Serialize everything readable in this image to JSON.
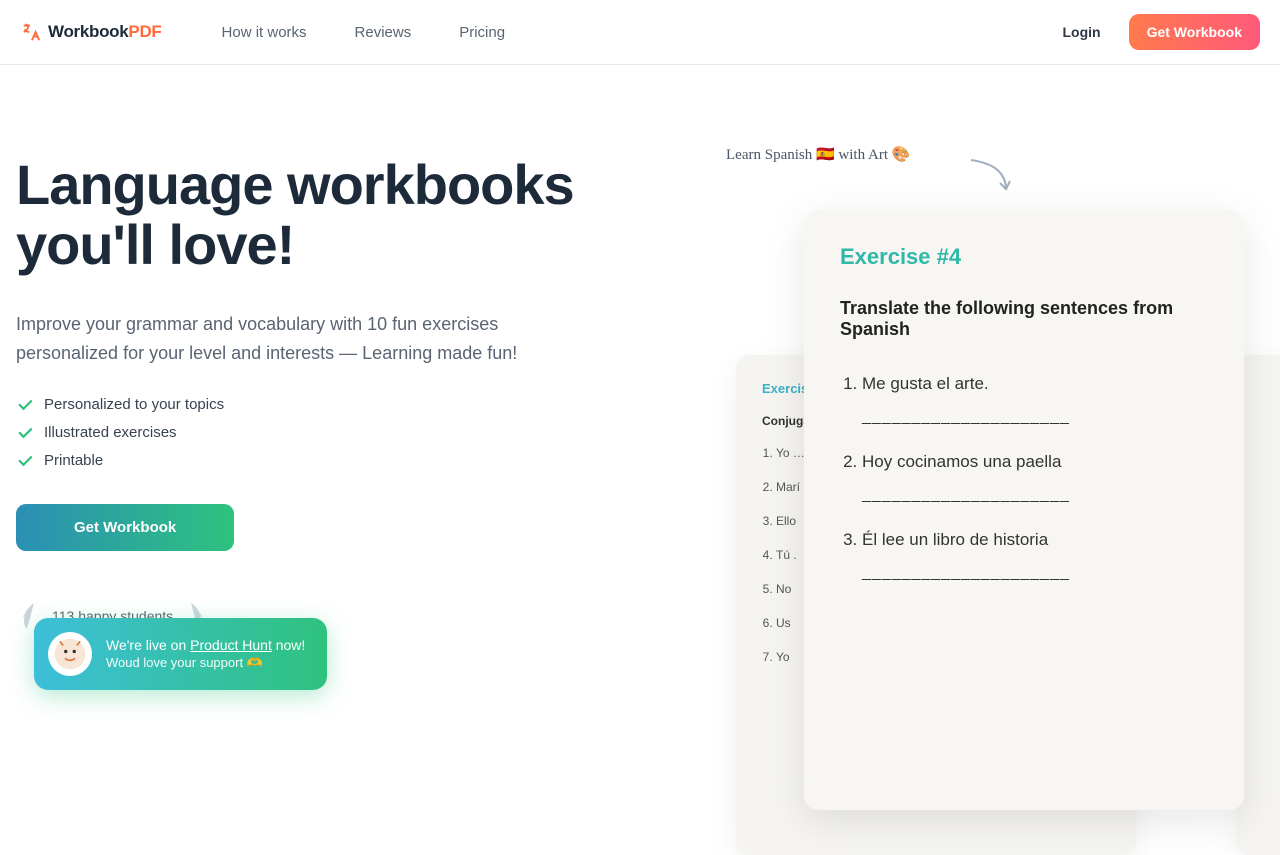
{
  "brand": {
    "name": "Workbook",
    "suffix": "PDF"
  },
  "nav": {
    "how": "How it works",
    "reviews": "Reviews",
    "pricing": "Pricing"
  },
  "auth": {
    "login": "Login",
    "cta": "Get Workbook"
  },
  "hero": {
    "title_l1": "Language workbooks",
    "title_l2": "you'll love!",
    "sub": "Improve your grammar and vocabulary with 10 fun exercises personalized for your level and interests — Learning made fun!",
    "features": [
      "Personalized to your topics",
      "Illustrated exercises",
      "Printable"
    ],
    "cta": "Get Workbook",
    "students": "113 happy students"
  },
  "preview": {
    "handwritten": "Learn Spanish 🇪🇸 with Art 🎨",
    "front": {
      "label": "Exercise #4",
      "instruction": "Translate the following sentences from Spanish",
      "items": [
        "Me gusta el arte.",
        "Hoy cocinamos una paella",
        "Él lee un libro de historia"
      ],
      "blank": "_____________________"
    },
    "back": {
      "label": "Exercise",
      "sub": "Conjugat",
      "items": [
        "Yo …",
        "Marí",
        "Ello",
        "Tú .",
        "No",
        "Us",
        "Yo"
      ]
    }
  },
  "toast": {
    "line1a": "We're live on ",
    "ph": "Product Hunt",
    "line1b": " now!",
    "line2": "Woud love your support 🫶"
  }
}
